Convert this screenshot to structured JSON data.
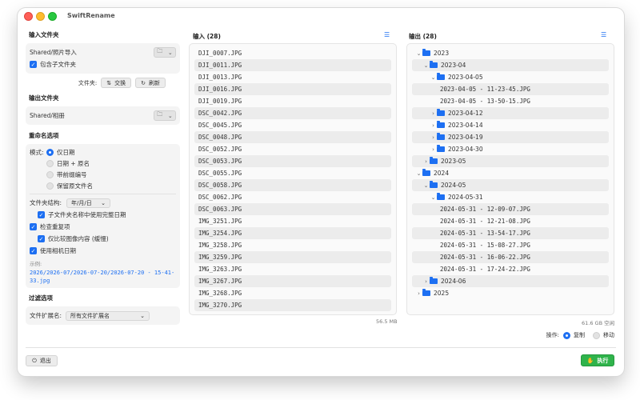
{
  "window": {
    "title": "SwiftRename"
  },
  "input_folder": {
    "section_title": "输入文件夹",
    "path": "Shared/照片导入",
    "include_subfolders_label": "包含子文件夹",
    "folder_label": "文件夹:",
    "swap_label": "交换",
    "refresh_label": "刷新"
  },
  "output_folder": {
    "section_title": "输出文件夹",
    "path": "Shared/相册"
  },
  "rename_options": {
    "section_title": "重命名选项",
    "mode_label": "模式:",
    "modes": [
      "仅日期",
      "日期 + 原名",
      "带前缀编号",
      "保留原文件名"
    ],
    "selected_mode": "仅日期",
    "folder_structure_label": "文件夹结构:",
    "folder_structure_value": "年/月/日",
    "use_full_date_label": "子文件夹名称中使用完整日期",
    "check_duplicates_label": "检查重复项",
    "compare_content_label": "仅比较图像内容 (缓慢)",
    "use_camera_date_label": "使用相机日期",
    "example_label": "示例:",
    "example_path": "2026/2026-07/2026-07-20/2026-07-20 - 15-41-33.jpg"
  },
  "filter_options": {
    "section_title": "过滤选项",
    "extension_label": "文件扩展名:",
    "extension_value": "所有文件扩展名"
  },
  "input_panel": {
    "title": "输入 (28)",
    "size": "56.5 MB",
    "files": [
      "DJI_0007.JPG",
      "DJI_0011.JPG",
      "DJI_0013.JPG",
      "DJI_0016.JPG",
      "DJI_0019.JPG",
      "DSC_0042.JPG",
      "DSC_0045.JPG",
      "DSC_0048.JPG",
      "DSC_0052.JPG",
      "DSC_0053.JPG",
      "DSC_0055.JPG",
      "DSC_0058.JPG",
      "DSC_0062.JPG",
      "DSC_0063.JPG",
      "IMG_3251.JPG",
      "IMG_3254.JPG",
      "IMG_3258.JPG",
      "IMG_3259.JPG",
      "IMG_3263.JPG",
      "IMG_3267.JPG",
      "IMG_3268.JPG",
      "IMG_3270.JPG"
    ]
  },
  "output_panel": {
    "title": "输出 (28)",
    "free_space": "61.6 GB 空闲",
    "tree": [
      {
        "label": "2023",
        "depth": 0,
        "type": "folder",
        "expanded": true
      },
      {
        "label": "2023-04",
        "depth": 1,
        "type": "folder",
        "expanded": true
      },
      {
        "label": "2023-04-05",
        "depth": 2,
        "type": "folder",
        "expanded": true
      },
      {
        "label": "2023-04-05 - 11-23-45.JPG",
        "depth": 3,
        "type": "file"
      },
      {
        "label": "2023-04-05 - 13-50-15.JPG",
        "depth": 3,
        "type": "file"
      },
      {
        "label": "2023-04-12",
        "depth": 2,
        "type": "folder",
        "expanded": false
      },
      {
        "label": "2023-04-14",
        "depth": 2,
        "type": "folder",
        "expanded": false
      },
      {
        "label": "2023-04-19",
        "depth": 2,
        "type": "folder",
        "expanded": false
      },
      {
        "label": "2023-04-30",
        "depth": 2,
        "type": "folder",
        "expanded": false
      },
      {
        "label": "2023-05",
        "depth": 1,
        "type": "folder",
        "expanded": false
      },
      {
        "label": "2024",
        "depth": 0,
        "type": "folder",
        "expanded": true
      },
      {
        "label": "2024-05",
        "depth": 1,
        "type": "folder",
        "expanded": true
      },
      {
        "label": "2024-05-31",
        "depth": 2,
        "type": "folder",
        "expanded": true
      },
      {
        "label": "2024-05-31 - 12-09-07.JPG",
        "depth": 3,
        "type": "file"
      },
      {
        "label": "2024-05-31 - 12-21-08.JPG",
        "depth": 3,
        "type": "file"
      },
      {
        "label": "2024-05-31 - 13-54-17.JPG",
        "depth": 3,
        "type": "file"
      },
      {
        "label": "2024-05-31 - 15-08-27.JPG",
        "depth": 3,
        "type": "file"
      },
      {
        "label": "2024-05-31 - 16-06-22.JPG",
        "depth": 3,
        "type": "file"
      },
      {
        "label": "2024-05-31 - 17-24-22.JPG",
        "depth": 3,
        "type": "file"
      },
      {
        "label": "2024-06",
        "depth": 1,
        "type": "folder",
        "expanded": false
      },
      {
        "label": "2025",
        "depth": 0,
        "type": "folder",
        "expanded": false
      }
    ]
  },
  "operation": {
    "label": "操作:",
    "copy_label": "复制",
    "move_label": "移动",
    "selected": "复制"
  },
  "footer": {
    "exit_label": "退出",
    "run_label": "执行"
  },
  "colors": {
    "accent": "#1d6ff2",
    "run": "#2fb34b"
  }
}
